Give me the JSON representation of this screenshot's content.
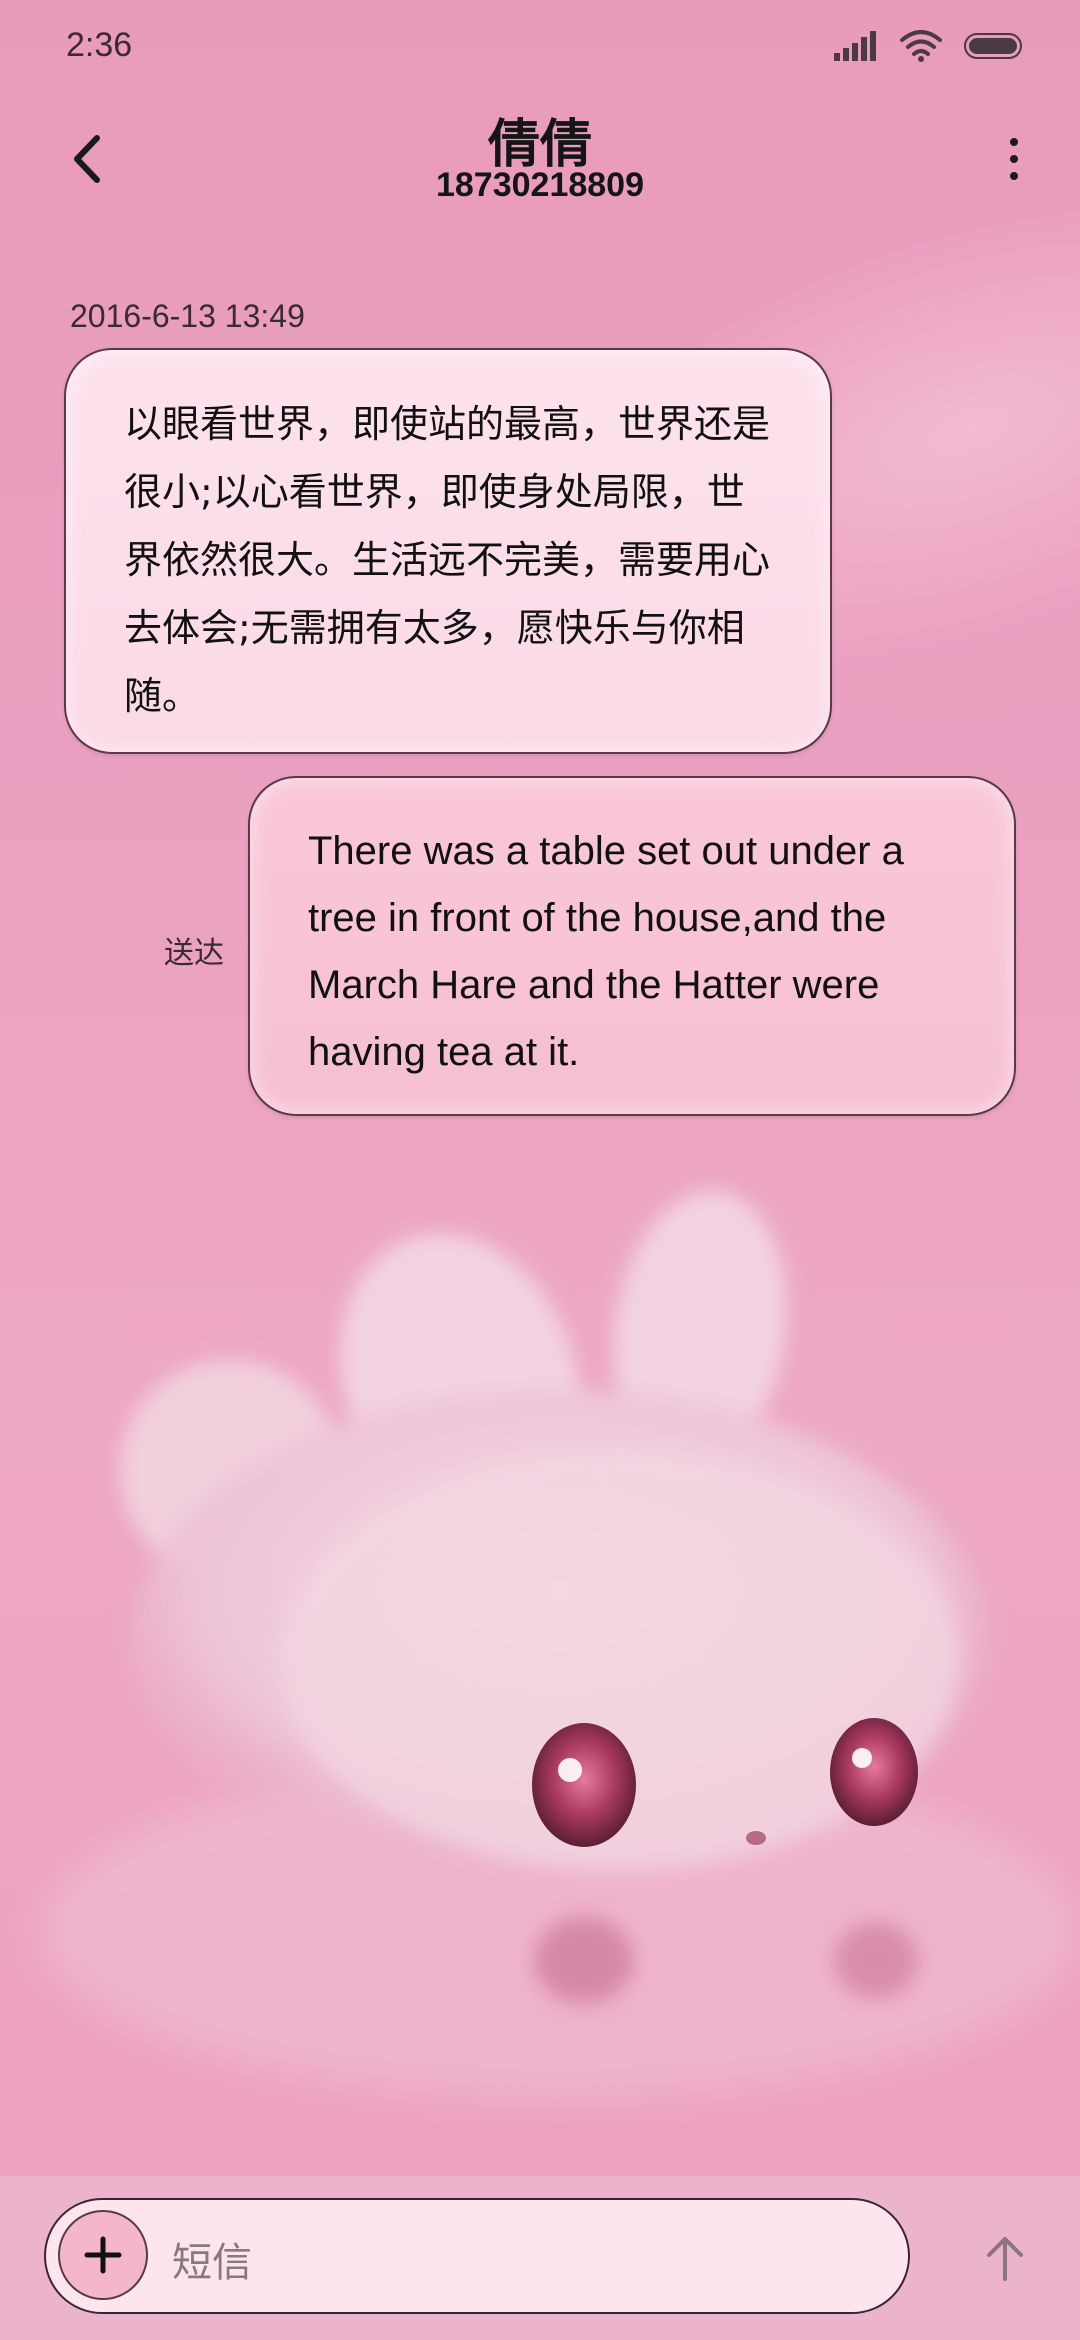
{
  "status_bar": {
    "time": "2:36",
    "signal_icon": "cellular-signal-icon",
    "wifi_icon": "wifi-icon",
    "battery_icon": "battery-icon"
  },
  "header": {
    "back_icon": "chevron-left-icon",
    "contact_name": "倩倩",
    "phone_number": "18730218809",
    "more_icon": "more-vertical-icon"
  },
  "conversation": {
    "timestamp": "2016-6-13 13:49",
    "messages": [
      {
        "direction": "incoming",
        "text": "以眼看世界，即使站的最高，世界还是很小;以心看世界，即使身处局限，世界依然很大。生活远不完美，需要用心去体会;无需拥有太多，愿快乐与你相随。"
      },
      {
        "direction": "outgoing",
        "text": "There was a table set out under a tree in front of the house,and the March Hare and the Hatter were having tea at it.",
        "status": "送达"
      }
    ]
  },
  "composer": {
    "add_icon": "plus-icon",
    "placeholder": "短信",
    "send_icon": "arrow-up-icon"
  },
  "colors": {
    "background": "#eaa1c0",
    "incoming_bubble": "#fde3ee",
    "outgoing_bubble": "#f8c5d7",
    "text": "#111111"
  }
}
